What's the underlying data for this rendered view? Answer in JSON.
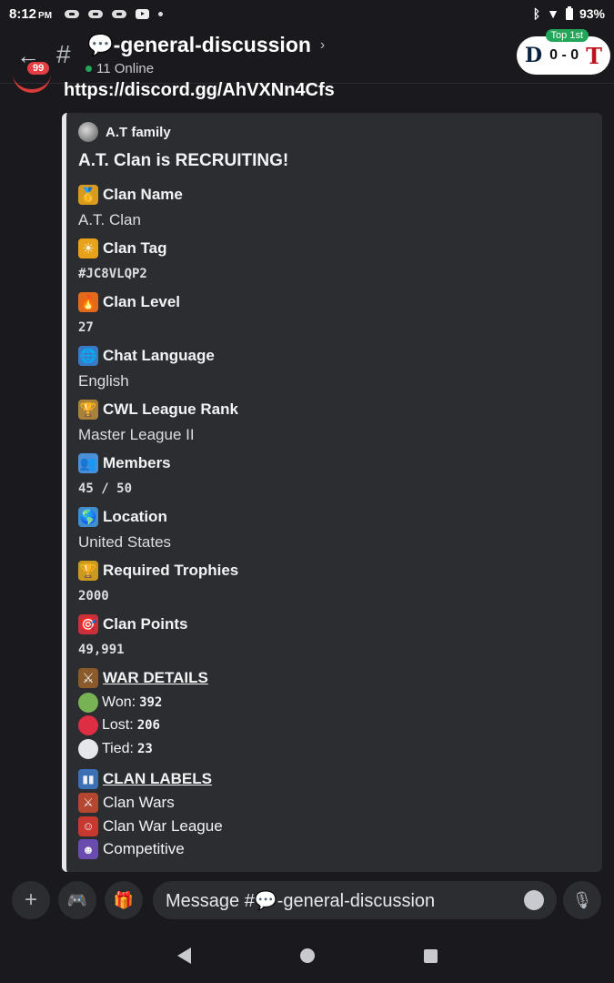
{
  "status": {
    "time": "8:12",
    "ampm": "PM",
    "battery": "93%"
  },
  "header": {
    "badge": "99",
    "channel": "💬-general-discussion",
    "online": "11 Online",
    "score": {
      "top_label": "Top 1st",
      "score": "0 - 0",
      "home": "D",
      "away": "T"
    }
  },
  "message": {
    "link": "https://discord.gg/AhVXNn4Cfs"
  },
  "embed": {
    "author": "A.T family",
    "title": "A.T. Clan is RECRUITING!",
    "fields": [
      {
        "icon": "medal-icon",
        "emoji": "🥇",
        "name": "Clan Name",
        "value": "A.T. Clan",
        "mono": false
      },
      {
        "icon": "sun-icon",
        "emoji": "☀",
        "name": "Clan Tag",
        "value": "#JC8VLQP2",
        "mono": true
      },
      {
        "icon": "fire-icon",
        "emoji": "🔥",
        "name": "Clan Level",
        "value": "27",
        "mono": true
      },
      {
        "icon": "globe-icon",
        "emoji": "🌐",
        "name": "Chat Language",
        "value": "English",
        "mono": false
      },
      {
        "icon": "league-icon",
        "emoji": "🏆",
        "name": "CWL League Rank",
        "value": "Master League II",
        "mono": false
      },
      {
        "icon": "members-icon",
        "emoji": "👥",
        "name": "Members",
        "value": "45 / 50",
        "mono": true
      },
      {
        "icon": "earth-icon",
        "emoji": "🌎",
        "name": "Location",
        "value": "United States",
        "mono": false
      },
      {
        "icon": "trophy-icon",
        "emoji": "🏆",
        "name": "Required Trophies",
        "value": "2000",
        "mono": true
      },
      {
        "icon": "target-icon",
        "emoji": "🎯",
        "name": "Clan Points",
        "value": "49,991",
        "mono": true
      }
    ],
    "war": {
      "heading": "WAR DETAILS",
      "won_label": "Won:",
      "won": "392",
      "lost_label": "Lost:",
      "lost": "206",
      "tied_label": "Tied:",
      "tied": "23"
    },
    "labels": {
      "heading": "CLAN LABELS",
      "items": [
        "Clan Wars",
        "Clan War League",
        "Competitive"
      ]
    }
  },
  "composer": {
    "placeholder": "Message #💬-general-discussion"
  },
  "colors": {
    "won": "#77b255",
    "lost": "#dd2e44",
    "tied": "#e6e7ea",
    "online": "#23a55a",
    "badge": "#e23e43"
  }
}
